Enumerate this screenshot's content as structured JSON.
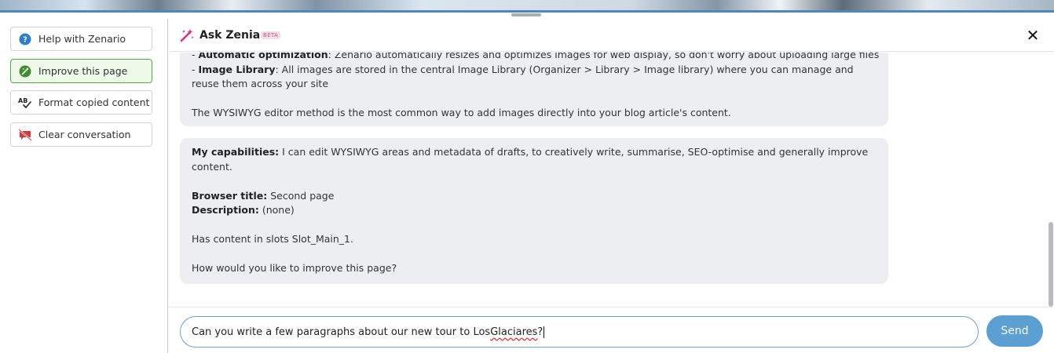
{
  "sidebar": {
    "buttons": [
      {
        "label": "Help with Zenario",
        "icon": "help-circle-icon"
      },
      {
        "label": "Improve this page",
        "icon": "improve-page-icon",
        "active": true
      },
      {
        "label": "Format copied content",
        "icon": "spellcheck-icon"
      },
      {
        "label": "Clear conversation",
        "icon": "clear-conversation-icon"
      }
    ]
  },
  "header": {
    "title": "Ask Zenia",
    "badge": "BETA",
    "close_icon": "close-icon"
  },
  "messages": {
    "m1": {
      "l1_prefix": "- ",
      "l1_bold": "Automatic optimization",
      "l1_text": ": Zenario automatically resizes and optimizes images for web display, so don't worry about uploading large files",
      "l2_prefix": "- ",
      "l2_bold": "Image Library",
      "l2_text": ": All images are stored in the central Image Library (Organizer > Library > Image library) where you can manage and",
      "l3_text": "reuse them across your site",
      "l4_text": "The WYSIWYG editor method is the most common way to add images directly into your blog article's content."
    },
    "m2": {
      "cap_bold": "My capabilities:",
      "cap_text_1": " I can edit WYSIWYG areas and metadata of drafts, to creatively write, summarise, SEO-optimise and generally improve",
      "cap_text_2": "content.",
      "bt_bold": "Browser title:",
      "bt_text": " Second page",
      "desc_bold": "Description:",
      "desc_text": " (none)",
      "slots_text": "Has content in slots Slot_Main_1.",
      "question": "How would you like to improve this page?"
    }
  },
  "composer": {
    "input_text_before": "Can you write a few paragraphs about our new tour to Los ",
    "input_text_misspelled": "Glaciares",
    "input_text_after": "?",
    "send_label": "Send"
  },
  "colors": {
    "accent_blue": "#5b9fd3",
    "input_border": "#6d9fca",
    "active_green": "#5aa54a",
    "wand_pink": "#d6317a",
    "bubble_bg": "#eceef1"
  }
}
